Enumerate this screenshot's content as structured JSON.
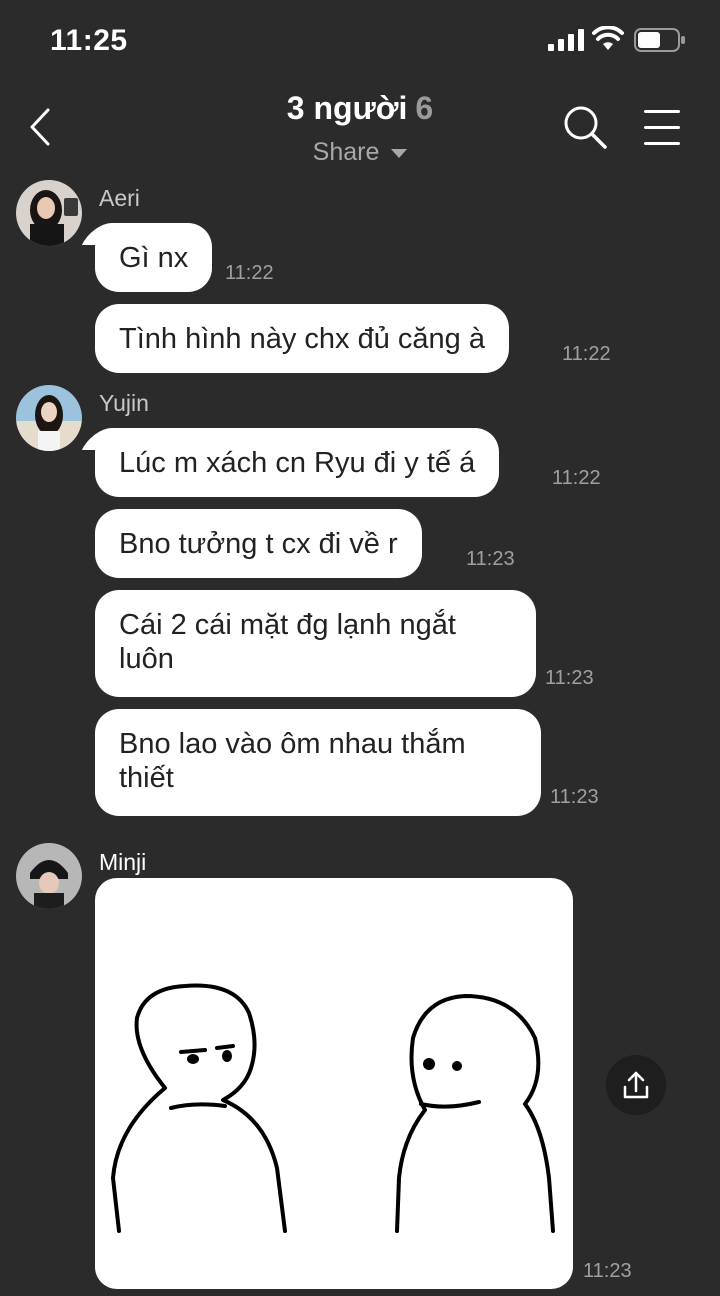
{
  "status_bar": {
    "time": "11:25"
  },
  "header": {
    "title": "3 người",
    "member_count": "6",
    "share_label": "Share"
  },
  "messages": [
    {
      "sender": "Aeri",
      "text": "Gì nx",
      "time": "11:22"
    },
    {
      "text": "Tình hình này chx đủ căng à",
      "time": "11:22"
    },
    {
      "sender": "Yujin",
      "text": "Lúc m xách cn Ryu đi y tế á",
      "time": "11:22"
    },
    {
      "text": "Bno tưởng t cx đi về r",
      "time": "11:23"
    },
    {
      "text": "Cái 2 cái mặt đg lạnh ngắt luôn",
      "time": "11:23"
    },
    {
      "text": "Bno lao vào ôm nhau thắm thiết",
      "time": "11:23"
    },
    {
      "sender": "Minji",
      "type": "image",
      "image": "two-stick-figures-sketch",
      "time": "11:23"
    }
  ],
  "icons": [
    "signal-icon",
    "wifi-icon",
    "battery-icon",
    "back-icon",
    "search-icon",
    "menu-icon",
    "caret-down-icon",
    "upload-icon"
  ],
  "colors": {
    "background": "#2b2b2b",
    "bubble": "#ffffff",
    "bubble_text": "#222222",
    "muted": "#a0a0a0"
  }
}
